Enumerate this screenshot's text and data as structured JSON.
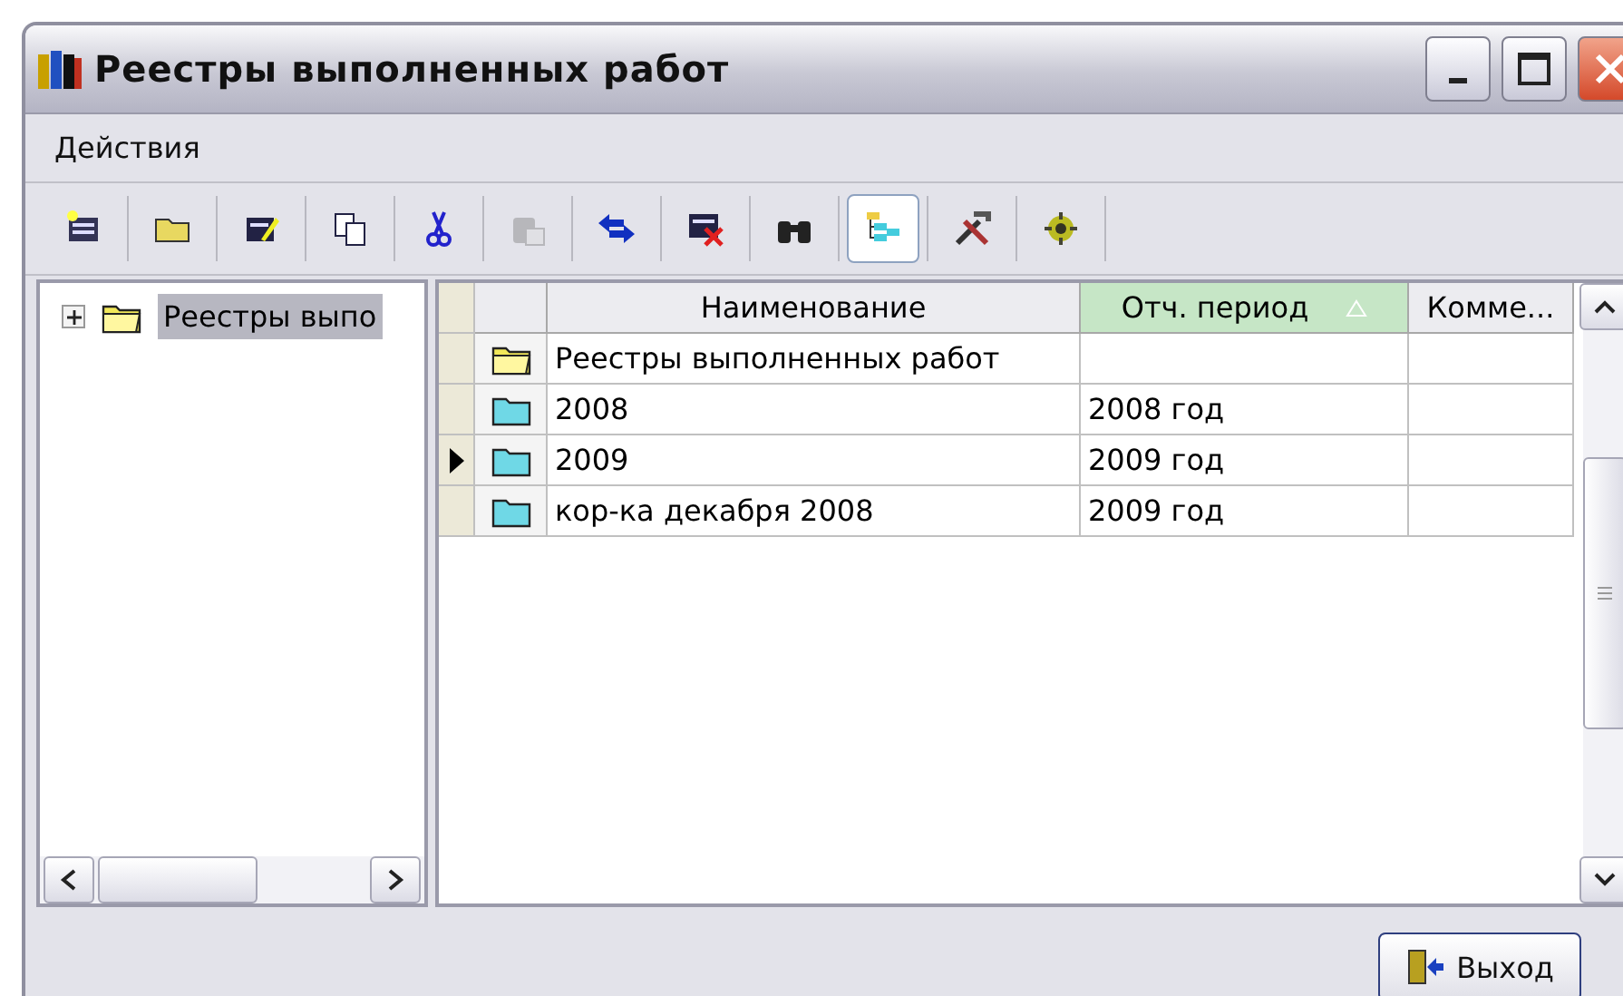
{
  "window": {
    "title": "Реестры выполненных работ"
  },
  "menu": [
    "Действия"
  ],
  "toolbar": [
    {
      "disabled": false,
      "selected": false
    },
    {
      "disabled": false,
      "selected": false
    },
    {
      "disabled": false,
      "selected": false
    },
    {
      "disabled": false,
      "selected": false
    },
    {
      "disabled": false,
      "selected": false
    },
    {
      "disabled": true,
      "selected": false
    },
    {
      "disabled": false,
      "selected": false
    },
    {
      "disabled": false,
      "selected": false
    },
    {
      "disabled": false,
      "selected": false
    },
    {
      "disabled": false,
      "selected": true
    },
    {
      "disabled": false,
      "selected": false
    },
    {
      "disabled": false,
      "selected": false
    }
  ],
  "tree": {
    "items": [
      {
        "label": "Реестры выпо",
        "expanded": false,
        "selected": true
      }
    ]
  },
  "table": {
    "columns": [
      {
        "label": "Наименование",
        "sorted": false
      },
      {
        "label": "Отч. период",
        "sorted": true
      },
      {
        "label": "Комме...",
        "sorted": false
      }
    ],
    "rows": [
      {
        "kind": "open-folder",
        "selected": false,
        "cells": [
          "Реестры выполненных работ",
          "",
          ""
        ]
      },
      {
        "kind": "folder",
        "selected": false,
        "cells": [
          "2008",
          "2008 год",
          ""
        ]
      },
      {
        "kind": "folder",
        "selected": true,
        "cells": [
          "2009",
          "2009 год",
          ""
        ]
      },
      {
        "kind": "folder",
        "selected": false,
        "cells": [
          "кор-ка декабря 2008",
          "2009 год",
          ""
        ]
      }
    ]
  },
  "buttons": [
    {
      "label": "Выход"
    }
  ]
}
